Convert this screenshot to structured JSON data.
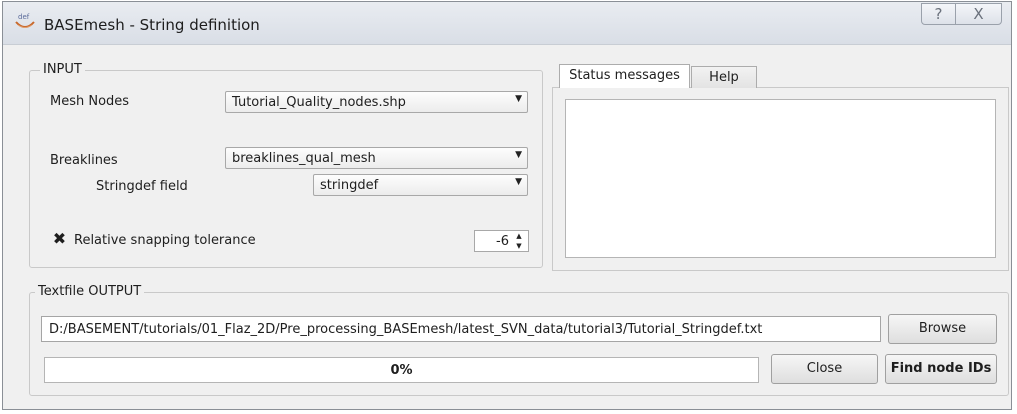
{
  "window": {
    "title": "BASEmesh - String definition",
    "app_icon_text": "def",
    "help_glyph": "?",
    "close_glyph": "X"
  },
  "input_group": {
    "title": "INPUT",
    "mesh_nodes_label": "Mesh Nodes",
    "mesh_nodes_value": "Tutorial_Quality_nodes.shp",
    "breaklines_label": "Breaklines",
    "breaklines_value": "breaklines_qual_mesh",
    "stringdef_label": "Stringdef field",
    "stringdef_value": "stringdef",
    "snapping_label": "Relative snapping tolerance",
    "snapping_checked": true,
    "snapping_check_glyph": "✖",
    "snapping_value": "-6"
  },
  "tabs": [
    {
      "label": "Status messages",
      "active": true
    },
    {
      "label": "Help",
      "active": false
    }
  ],
  "output_group": {
    "title": "Textfile OUTPUT",
    "path_value": "D:/BASEMENT/tutorials/01_Flaz_2D/Pre_processing_BASEmesh/latest_SVN_data/tutorial3/Tutorial_Stringdef.txt",
    "browse_label": "Browse"
  },
  "progress": {
    "text": "0%",
    "value": 0
  },
  "buttons": {
    "close_label": "Close",
    "find_label": "Find node IDs"
  },
  "glyphs": {
    "combo_arrow": "▼",
    "spin_up": "▲",
    "spin_down": "▼"
  }
}
